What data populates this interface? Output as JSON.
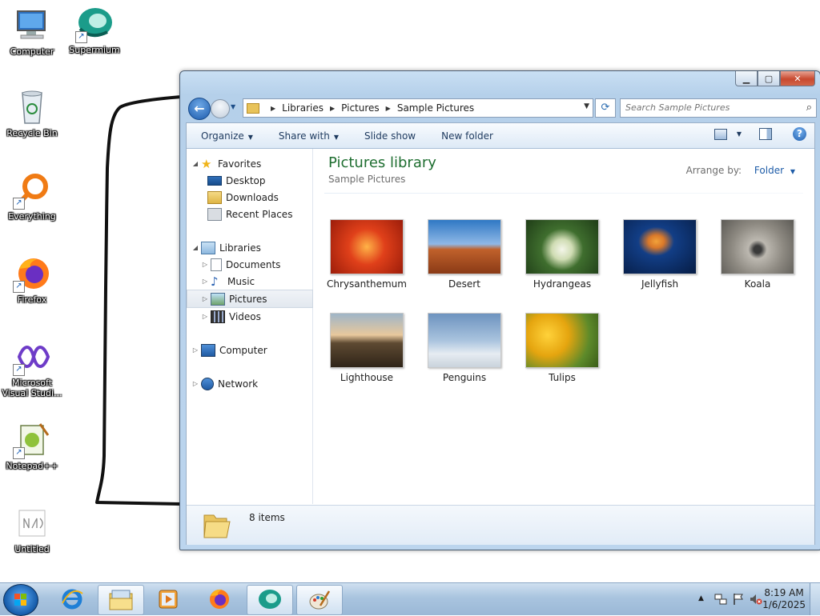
{
  "desktop": {
    "icons": [
      {
        "label": "Computer"
      },
      {
        "label": "Supermium"
      },
      {
        "label": "Recycle Bin"
      },
      {
        "label": "Everything"
      },
      {
        "label": "Firefox"
      },
      {
        "label": "Microsoft Visual Studi..."
      },
      {
        "label": "Notepad++"
      },
      {
        "label": "Untitled"
      }
    ]
  },
  "window": {
    "address": {
      "crumbs": [
        "Libraries",
        "Pictures",
        "Sample Pictures"
      ]
    },
    "search": {
      "placeholder": "Search Sample Pictures"
    },
    "toolbar": {
      "organize": "Organize",
      "share_with": "Share with",
      "slide_show": "Slide show",
      "new_folder": "New folder"
    },
    "nav": {
      "favorites": "Favorites",
      "desktop": "Desktop",
      "downloads": "Downloads",
      "recent_places": "Recent Places",
      "libraries": "Libraries",
      "documents": "Documents",
      "music": "Music",
      "pictures": "Pictures",
      "videos": "Videos",
      "computer": "Computer",
      "network": "Network"
    },
    "content": {
      "title": "Pictures library",
      "subtitle": "Sample Pictures",
      "arrange_label": "Arrange by:",
      "arrange_value": "Folder",
      "items": [
        {
          "name": "Chrysanthemum",
          "color": "#d9361a"
        },
        {
          "name": "Desert",
          "color": "#b4582a"
        },
        {
          "name": "Hydrangeas",
          "color": "#4f7a3a"
        },
        {
          "name": "Jellyfish",
          "color": "#0d3f8a"
        },
        {
          "name": "Koala",
          "color": "#8f8a82"
        },
        {
          "name": "Lighthouse",
          "color": "#6f5a3e"
        },
        {
          "name": "Penguins",
          "color": "#6c8fb7"
        },
        {
          "name": "Tulips",
          "color": "#e0ac12"
        }
      ]
    },
    "details": {
      "count": "8 items"
    }
  },
  "taskbar": {
    "clock_time": "8:19 AM",
    "clock_date": "1/6/2025"
  }
}
